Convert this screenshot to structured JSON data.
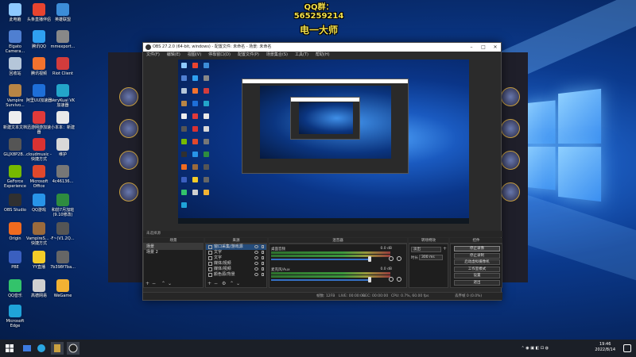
{
  "overlay": {
    "qq_line": "QQ群：565259214",
    "name_line": "电一大师"
  },
  "desktop_icons": [
    {
      "label": "此电脑",
      "color": "#8ec9ff"
    },
    {
      "label": "头条直播伴侣",
      "color": "#e8442f"
    },
    {
      "label": "英雄联盟",
      "color": "#3c8dd8"
    },
    {
      "label": "Elgato Camera...",
      "color": "#4f7fd1"
    },
    {
      "label": "腾讯QQ",
      "color": "#2fa0f0"
    },
    {
      "label": "mmexport...",
      "color": "#888"
    },
    {
      "label": "回收站",
      "color": "#b5c6d9"
    },
    {
      "label": "腾讯视频",
      "color": "#f2722e"
    },
    {
      "label": "Riot Client",
      "color": "#d23c3c"
    },
    {
      "label": "Vampire Survivo...",
      "color": "#b88545"
    },
    {
      "label": "阿里UU加速器",
      "color": "#1e6fd8"
    },
    {
      "label": "VeryKuai VK加速器",
      "color": "#23a5c9"
    },
    {
      "label": "新建文本文档",
      "color": "#eeeeee"
    },
    {
      "label": "迅游网游加速器",
      "color": "#e03a3a"
    },
    {
      "label": "小本本：新建",
      "color": "#e9e9e9"
    },
    {
      "label": "GLJX8P2B...",
      "color": "#555"
    },
    {
      "label": "cloudmusic - 快捷方式",
      "color": "#d93232"
    },
    {
      "label": "维护",
      "color": "#d8d8d8"
    },
    {
      "label": "GeForce Experience",
      "color": "#76b900"
    },
    {
      "label": "Microsoft Office",
      "color": "#e0482c"
    },
    {
      "label": "4c46136...",
      "color": "#777"
    },
    {
      "label": "OBS Studio",
      "color": "#303030"
    },
    {
      "label": "QQ游戏",
      "color": "#2894e8"
    },
    {
      "label": "和前7月加班(9.10修改)",
      "color": "#2e8c3f"
    },
    {
      "label": "Origin",
      "color": "#f06b1f"
    },
    {
      "label": "VampireS... - 快捷方式",
      "color": "#9a6a3c"
    },
    {
      "label": "F~(V1.2Q...",
      "color": "#555"
    },
    {
      "label": "PBE",
      "color": "#3a5fbf"
    },
    {
      "label": "YY直播",
      "color": "#f4cc28"
    },
    {
      "label": "7b398f7ba...",
      "color": "#666"
    },
    {
      "label": "QQ音乐",
      "color": "#33c36b"
    },
    {
      "label": "高德网易",
      "color": "#d0d0d0"
    },
    {
      "label": "WeGame",
      "color": "#f2b233"
    },
    {
      "label": "Microsoft Edge",
      "color": "#1fa3d8"
    }
  ],
  "obs": {
    "title": "OBS 27.2.0 (64-bit, windows) - 配置文件: 未命名 - 场景: 未命名",
    "menu": [
      "文件(F)",
      "编辑(E)",
      "视图(V)",
      "停靠窗口(D)",
      "配置文件(P)",
      "场景集合(S)",
      "工具(T)",
      "帮助(H)"
    ],
    "scenes_status": "未选择源",
    "docks": {
      "scenes_header": "场景",
      "sources_header": "来源",
      "mixer_header": "混音器",
      "transitions_header": "转场特效",
      "controls_header": "控件"
    },
    "scenes": [
      "场景",
      "场景 2"
    ],
    "sources": [
      "窗口采集/游戏源",
      "文字",
      "文字",
      "媒体/视频",
      "媒体/视频",
      "颜色源/背景"
    ],
    "mixer": [
      {
        "name": "桌面音频",
        "db": "0.0 dB"
      },
      {
        "name": "麦克风/Aux",
        "db": "0.0 dB"
      }
    ],
    "transition": {
      "type": "淡出",
      "duration_label": "时长",
      "duration": "300 ms"
    },
    "controls": [
      "停止录像",
      "停止录制",
      "启动虚拟摄像机",
      "工作室模式",
      "设置",
      "退出"
    ],
    "status": {
      "live": "LIVE: 00:00:00",
      "rec": "REC: 00:00:00",
      "cpu": "CPU: 0.7%, 60.00 fps",
      "frames": "帧数: 12FB",
      "dropped": "丢弃帧 0 (0.0%)"
    }
  },
  "taskbar": {
    "time": "19:46",
    "date": "2022/8/14"
  }
}
